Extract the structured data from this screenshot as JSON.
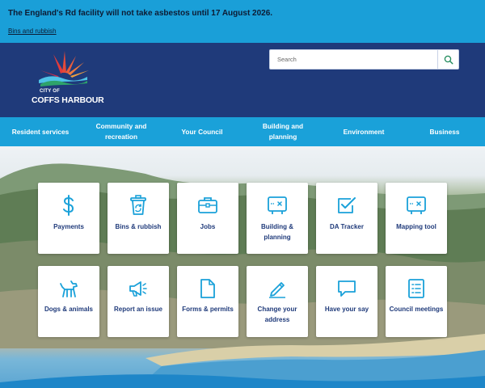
{
  "alert": {
    "message": "The England's Rd facility will not take asbestos until 17 August 2026.",
    "link": "Bins and rubbish"
  },
  "header": {
    "logo_line1": "CITY OF",
    "logo_line2": "COFFS HARBOUR",
    "search_placeholder": "Search"
  },
  "nav": {
    "items": [
      "Resident services",
      "Community and recreation",
      "Your Council",
      "Building and planning",
      "Environment",
      "Business"
    ]
  },
  "tiles": [
    {
      "label": "Payments",
      "icon": "dollar-icon"
    },
    {
      "label": "Bins & rubbish",
      "icon": "recycle-bin-icon"
    },
    {
      "label": "Jobs",
      "icon": "briefcase-icon"
    },
    {
      "label": "Building & planning",
      "icon": "plan-icon"
    },
    {
      "label": "DA Tracker",
      "icon": "checkbox-icon"
    },
    {
      "label": "Mapping tool",
      "icon": "map-icon"
    },
    {
      "label": "Dogs & animals",
      "icon": "dog-icon"
    },
    {
      "label": "Report an issue",
      "icon": "megaphone-icon"
    },
    {
      "label": "Forms & permits",
      "icon": "document-icon"
    },
    {
      "label": "Change your address",
      "icon": "pencil-icon"
    },
    {
      "label": "Have your say",
      "icon": "speech-bubble-icon"
    },
    {
      "label": "Council meetings",
      "icon": "list-icon"
    }
  ],
  "colors": {
    "alert_bg": "#1a9fd8",
    "header_bg": "#1f3a7a",
    "nav_bg": "#1aa1d9",
    "icon": "#1aa1d9",
    "tile_text": "#1f3a7a"
  }
}
